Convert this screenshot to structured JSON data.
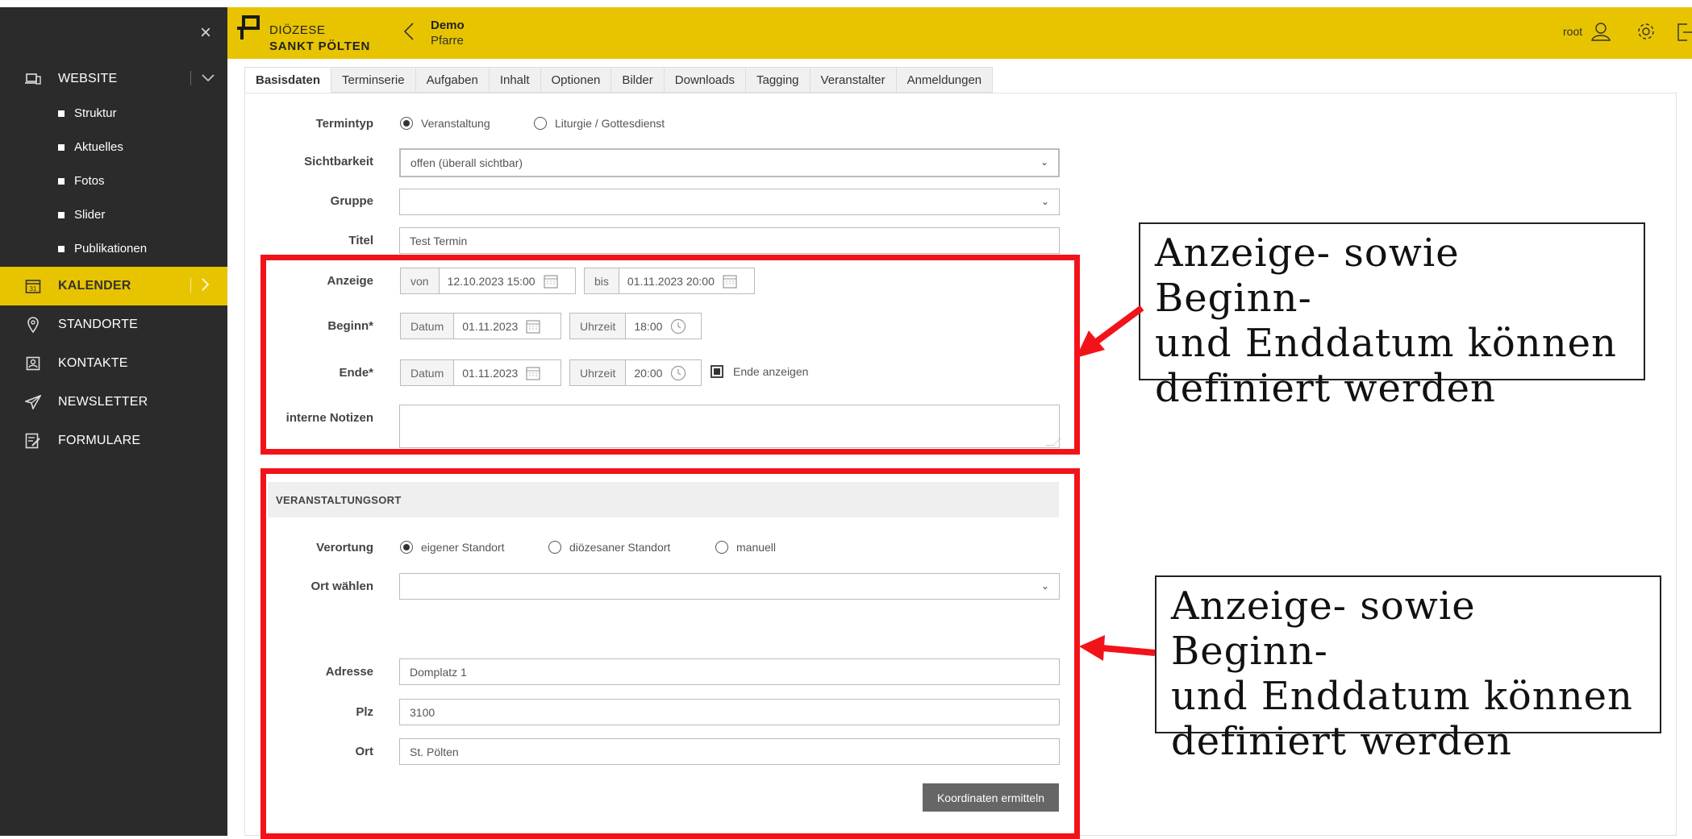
{
  "sidebar": {
    "close_label": "×",
    "items": [
      {
        "label": "WEBSITE",
        "icon": "laptop-icon"
      },
      {
        "label": "KALENDER",
        "icon": "calendar-icon"
      },
      {
        "label": "STANDORTE",
        "icon": "map-pin-icon"
      },
      {
        "label": "KONTAKTE",
        "icon": "contact-card-icon"
      },
      {
        "label": "NEWSLETTER",
        "icon": "send-icon"
      },
      {
        "label": "FORMULARE",
        "icon": "form-edit-icon"
      }
    ],
    "website_sub": [
      "Struktur",
      "Aktuelles",
      "Fotos",
      "Slider",
      "Publikationen"
    ]
  },
  "header": {
    "logo_line1": "DIÖZESE",
    "logo_line2": "SANKT PÖLTEN",
    "title": "Demo",
    "subtitle": "Pfarre",
    "user": "root",
    "accent": "#e8c400"
  },
  "tabs": [
    "Basisdaten",
    "Terminserie",
    "Aufgaben",
    "Inhalt",
    "Optionen",
    "Bilder",
    "Downloads",
    "Tagging",
    "Veranstalter",
    "Anmeldungen"
  ],
  "form": {
    "termintyp": {
      "label": "Termintyp",
      "options": [
        "Veranstaltung",
        "Liturgie / Gottesdienst"
      ],
      "selected": "Veranstaltung"
    },
    "sichtbarkeit": {
      "label": "Sichtbarkeit",
      "value": "offen (überall sichtbar)"
    },
    "gruppe": {
      "label": "Gruppe",
      "value": ""
    },
    "titel": {
      "label": "Titel",
      "value": "Test Termin"
    },
    "anzeige": {
      "label": "Anzeige",
      "von_label": "von",
      "von": "12.10.2023 15:00",
      "bis_label": "bis",
      "bis": "01.11.2023 20:00"
    },
    "beginn": {
      "label": "Beginn*",
      "datum_label": "Datum",
      "datum": "01.11.2023",
      "uhrzeit_label": "Uhrzeit",
      "uhrzeit": "18:00"
    },
    "ende": {
      "label": "Ende*",
      "datum_label": "Datum",
      "datum": "01.11.2023",
      "uhrzeit_label": "Uhrzeit",
      "uhrzeit": "20:00",
      "checkbox_label": "Ende anzeigen",
      "checked": true
    },
    "notizen": {
      "label": "interne Notizen",
      "value": ""
    }
  },
  "ort": {
    "section_title": "VERANSTALTUNGSORT",
    "verortung": {
      "label": "Verortung",
      "options": [
        "eigener Standort",
        "diözesaner Standort",
        "manuell"
      ],
      "selected": "eigener Standort"
    },
    "ort_waehlen": {
      "label": "Ort wählen",
      "value": ""
    },
    "adresse": {
      "label": "Adresse",
      "value": "Domplatz 1"
    },
    "plz": {
      "label": "Plz",
      "value": "3100"
    },
    "ort": {
      "label": "Ort",
      "value": "St. Pölten"
    },
    "button": "Koordinaten ermitteln"
  },
  "annotations": {
    "callout1": [
      "Anzeige- sowie Beginn-",
      "und Enddatum können",
      "definiert werden"
    ],
    "callout2": [
      "Anzeige- sowie Beginn-",
      "und Enddatum können",
      "definiert werden"
    ],
    "color": "#f2131a"
  }
}
